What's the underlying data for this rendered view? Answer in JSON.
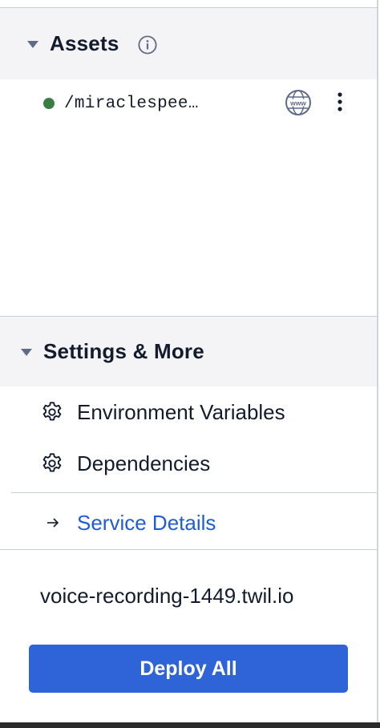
{
  "assets": {
    "title": "Assets",
    "info_icon": "info-circle-icon",
    "items": [
      {
        "path": "/miraclespee…",
        "status_color": "#3a7d44",
        "visibility_icon": "www-globe-icon",
        "menu_icon": "kebab-menu-icon"
      }
    ]
  },
  "settings": {
    "title": "Settings & More",
    "items": [
      {
        "label": "Environment Variables",
        "icon": "gear-icon"
      },
      {
        "label": "Dependencies",
        "icon": "gear-icon"
      }
    ],
    "service_link": {
      "label": "Service Details",
      "icon": "arrow-right-icon"
    }
  },
  "footer": {
    "domain": "voice-recording-1449.twil.io",
    "deploy_label": "Deploy All"
  },
  "colors": {
    "accent": "#2f63d8",
    "link": "#1f5dd6",
    "status_ok": "#3a7d44",
    "header_bg": "#f4f4f6"
  }
}
